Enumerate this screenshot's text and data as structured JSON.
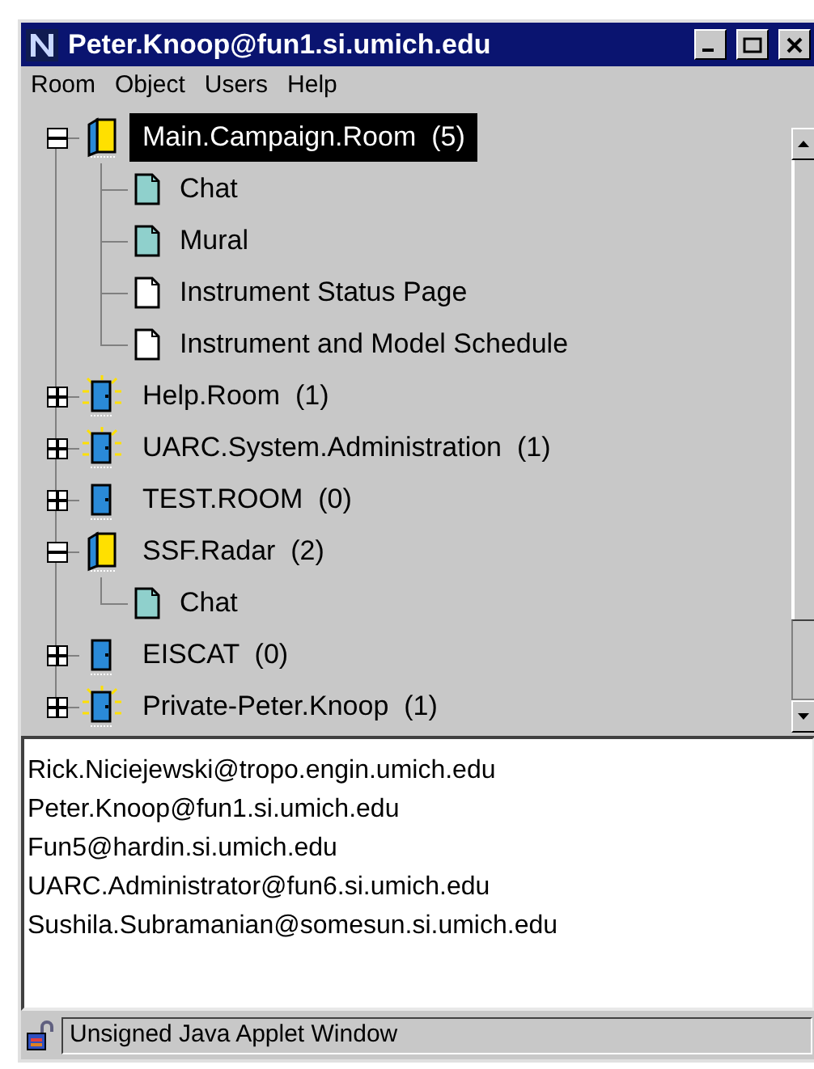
{
  "window": {
    "title": "Peter.Knoop@fun1.si.umich.edu"
  },
  "menu": [
    "Room",
    "Object",
    "Users",
    "Help"
  ],
  "rooms": [
    {
      "name": "Main.Campaign.Room  (5)",
      "expanded": true,
      "occupied": true,
      "selected": true,
      "children": [
        {
          "name": "Chat",
          "kind": "shared"
        },
        {
          "name": "Mural",
          "kind": "shared"
        },
        {
          "name": "Instrument Status Page",
          "kind": "page"
        },
        {
          "name": "Instrument and Model Schedule",
          "kind": "page"
        }
      ]
    },
    {
      "name": "Help.Room  (1)",
      "expanded": false,
      "occupied": true,
      "selected": false
    },
    {
      "name": "UARC.System.Administration  (1)",
      "expanded": false,
      "occupied": true,
      "selected": false
    },
    {
      "name": "TEST.ROOM  (0)",
      "expanded": false,
      "occupied": false,
      "selected": false
    },
    {
      "name": "SSF.Radar  (2)",
      "expanded": true,
      "occupied": true,
      "selected": false,
      "children": [
        {
          "name": "Chat",
          "kind": "shared"
        }
      ]
    },
    {
      "name": "EISCAT  (0)",
      "expanded": false,
      "occupied": false,
      "selected": false
    },
    {
      "name": "Private-Peter.Knoop  (1)",
      "expanded": false,
      "occupied": true,
      "selected": false
    }
  ],
  "users": [
    "Rick.Niciejewski@tropo.engin.umich.edu",
    "Peter.Knoop@fun1.si.umich.edu",
    "Fun5@hardin.si.umich.edu",
    "UARC.Administrator@fun6.si.umich.edu",
    "Sushila.Subramanian@somesun.si.umich.edu"
  ],
  "status_bar": "Unsigned Java Applet Window"
}
